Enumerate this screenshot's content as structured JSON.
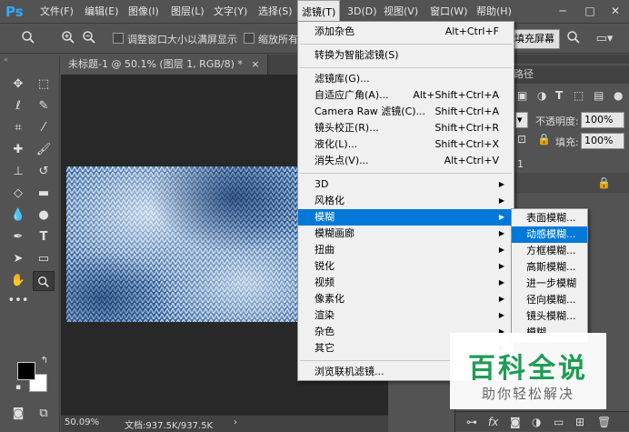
{
  "app": {
    "logo": "Ps"
  },
  "menubar": {
    "items": [
      {
        "label": "文件(F)"
      },
      {
        "label": "编辑(E)"
      },
      {
        "label": "图像(I)"
      },
      {
        "label": "图层(L)"
      },
      {
        "label": "文字(Y)"
      },
      {
        "label": "选择(S)"
      },
      {
        "label": "滤镜(T)"
      },
      {
        "label": "3D(D)"
      },
      {
        "label": "视图(V)"
      },
      {
        "label": "窗口(W)"
      },
      {
        "label": "帮助(H)"
      }
    ],
    "active_index": 6
  },
  "options_bar": {
    "resize_windows_label": "调整窗口大小以满屏显示",
    "zoom_all_label": "缩放所有",
    "fill_screen_label": "填充屏幕"
  },
  "document": {
    "tab_title": "未标题-1 @ 50.1% (图层 1, RGB/8) *",
    "tab_close": "×",
    "zoom": "50.09%",
    "doc_size": "文档:937.5K/937.5K"
  },
  "right_panel": {
    "path_tab": "路径",
    "opacity_label": "不透明度:",
    "opacity_value": "100%",
    "fill_label": "填充:",
    "fill_value": "100%",
    "layer_number": "1",
    "fx_label": "fx"
  },
  "filter_menu": {
    "groups": [
      [
        {
          "label": "添加杂色",
          "shortcut": "Alt+Ctrl+F"
        }
      ],
      [
        {
          "label": "转换为智能滤镜(S)",
          "shortcut": ""
        }
      ],
      [
        {
          "label": "滤镜库(G)...",
          "shortcut": ""
        },
        {
          "label": "自适应广角(A)...",
          "shortcut": "Alt+Shift+Ctrl+A"
        },
        {
          "label": "Camera Raw 滤镜(C)...",
          "shortcut": "Shift+Ctrl+A"
        },
        {
          "label": "镜头校正(R)...",
          "shortcut": "Shift+Ctrl+R"
        },
        {
          "label": "液化(L)...",
          "shortcut": "Shift+Ctrl+X"
        },
        {
          "label": "消失点(V)...",
          "shortcut": "Alt+Ctrl+V"
        }
      ],
      [
        {
          "label": "3D",
          "submenu": true
        },
        {
          "label": "风格化",
          "submenu": true
        },
        {
          "label": "模糊",
          "submenu": true,
          "highlighted": true
        },
        {
          "label": "模糊画廊",
          "submenu": true
        },
        {
          "label": "扭曲",
          "submenu": true
        },
        {
          "label": "锐化",
          "submenu": true
        },
        {
          "label": "视频",
          "submenu": true
        },
        {
          "label": "像素化",
          "submenu": true
        },
        {
          "label": "渲染",
          "submenu": true
        },
        {
          "label": "杂色",
          "submenu": true
        },
        {
          "label": "其它",
          "submenu": true
        }
      ],
      [
        {
          "label": "浏览联机滤镜...",
          "shortcut": ""
        }
      ]
    ]
  },
  "blur_submenu": {
    "items": [
      {
        "label": "表面模糊..."
      },
      {
        "label": "动感模糊...",
        "highlighted": true
      },
      {
        "label": "方框模糊..."
      },
      {
        "label": "高斯模糊..."
      },
      {
        "label": "进一步模糊"
      },
      {
        "label": "径向模糊..."
      },
      {
        "label": "镜头模糊..."
      },
      {
        "label": "模糊"
      }
    ]
  },
  "watermark": {
    "title": "百科全说",
    "subtitle": "助你轻松解决"
  },
  "colors": {
    "highlight": "#0078d7",
    "menu_bg": "#f0f0f0",
    "ps_blue": "#31a8ff",
    "watermark_green": "#1f9c55"
  }
}
